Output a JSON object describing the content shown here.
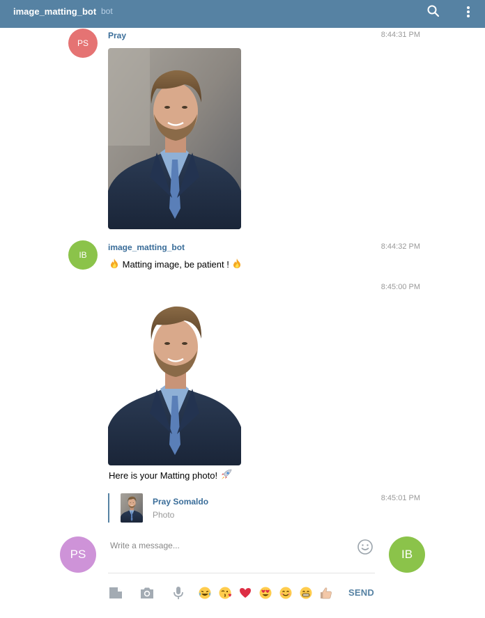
{
  "header": {
    "title": "image_matting_bot",
    "subtitle": "bot"
  },
  "messages": [
    {
      "avatar_initials": "PS",
      "avatar_color": "#e57373",
      "author": "Pray",
      "time": "8:44:31 PM",
      "content": "photo"
    },
    {
      "avatar_initials": "IB",
      "avatar_color": "#8bc34a",
      "author": "image_matting_bot",
      "time": "8:44:32 PM",
      "text": "Matting image, be patient !"
    },
    {
      "time": "8:45:00 PM",
      "content": "photo-matted",
      "caption": "Here is your Matting photo!"
    },
    {
      "time": "8:45:01 PM",
      "reply_author": "Pray Somaldo",
      "reply_type": "Photo"
    }
  ],
  "composer": {
    "placeholder": "Write a message...",
    "left_avatar": "PS",
    "left_avatar_color": "#ce93d8",
    "right_avatar": "IB",
    "right_avatar_color": "#8bc34a",
    "send_label": "SEND",
    "tools": [
      "file-icon",
      "camera-icon",
      "microphone-icon"
    ],
    "quick_emojis": [
      "tears-of-joy-emoji",
      "kissing-emoji",
      "heart-emoji",
      "heart-eyes-emoji",
      "smile-emoji",
      "grin-emoji",
      "thumbs-up-emoji"
    ]
  },
  "colors": {
    "header": "#5682a3",
    "link": "#3a6d99",
    "muted": "#999999"
  }
}
